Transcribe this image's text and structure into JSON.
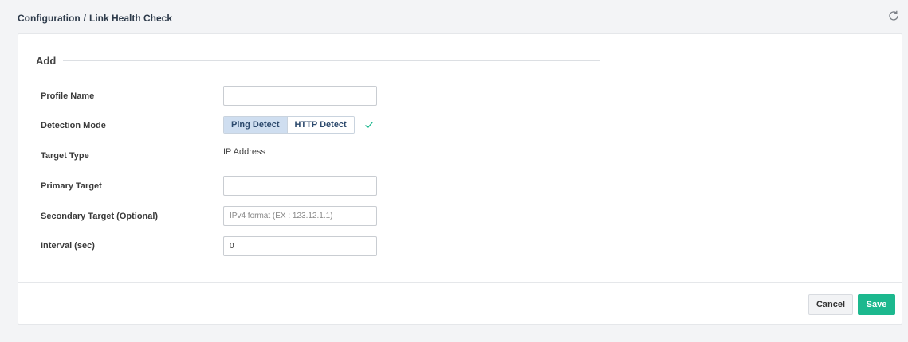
{
  "breadcrumb": {
    "section": "Configuration",
    "separator": "/",
    "page": "Link Health Check"
  },
  "icons": {
    "refresh": "refresh-icon",
    "check": "checkmark-icon"
  },
  "form": {
    "legend": "Add",
    "profile_name": {
      "label": "Profile Name",
      "value": "",
      "placeholder": ""
    },
    "detection_mode": {
      "label": "Detection Mode",
      "options": [
        "Ping Detect",
        "HTTP Detect"
      ],
      "selected": "Ping Detect"
    },
    "target_type": {
      "label": "Target Type",
      "value": "IP Address"
    },
    "primary_target": {
      "label": "Primary Target",
      "value": "",
      "placeholder": ""
    },
    "secondary_target": {
      "label": "Secondary Target (Optional)",
      "value": "",
      "placeholder": "IPv4 format (EX : 123.12.1.1)"
    },
    "interval": {
      "label": "Interval (sec)",
      "value": "0"
    }
  },
  "footer": {
    "cancel_label": "Cancel",
    "save_label": "Save"
  },
  "colors": {
    "accent": "#1cb88e",
    "segment_active": "#cfdef0",
    "check": "#1cb88e"
  }
}
